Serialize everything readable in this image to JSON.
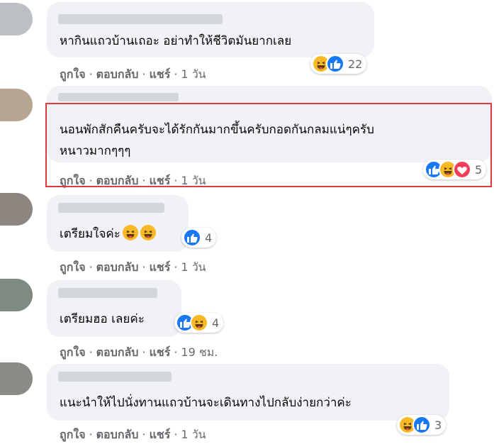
{
  "comments": [
    {
      "text": "หากินแถวบ้านเถอะ อย่าทำให้ชีวิตมันยากเลย",
      "actions": {
        "like": "ถูกใจ",
        "reply": "ตอบกลับ",
        "share": "แชร์",
        "time": "1 วัน"
      },
      "reaction_count": "22",
      "reaction_icons": [
        "haha-icon",
        "like-icon"
      ]
    },
    {
      "text_lines": [
        "นอนพักสักคืนครับจะได้รักกันมากขึ้นครับกอดกันกลมแน่ๆครับ",
        "หนาวมากๆๆๆ"
      ],
      "actions": {
        "like": "ถูกใจ",
        "reply": "ตอบกลับ",
        "share": "แชร์",
        "time": "1 วัน"
      },
      "reaction_count": "5",
      "reaction_icons": [
        "like-icon",
        "haha-icon",
        "love-icon"
      ]
    },
    {
      "text": "เตรียมใจค่ะ",
      "inline_emojis": [
        "rolling-laughing-emoji",
        "grinning-squint-emoji"
      ],
      "actions": {
        "like": "ถูกใจ",
        "reply": "ตอบกลับ",
        "share": "แชร์",
        "time": "1 วัน"
      },
      "reaction_count": "4",
      "reaction_icons": [
        "like-icon"
      ]
    },
    {
      "text": "เตรียมฮอ เลยค่ะ",
      "actions": {
        "like": "ถูกใจ",
        "reply": "ตอบกลับ",
        "share": "แชร์",
        "time": "19 ชม."
      },
      "reaction_count": "4",
      "reaction_icons": [
        "like-icon",
        "haha-icon"
      ]
    },
    {
      "text": "แนะนำให้ไปนั่งทานแถวบ้านจะเดินทางไปกลับง่ายกว่าค่ะ",
      "actions": {
        "like": "ถูกใจ",
        "reply": "ตอบกลับ",
        "share": "แชร์",
        "time": "1 วัน"
      },
      "reaction_count": "3",
      "reaction_icons": [
        "haha-icon",
        "like-icon"
      ]
    }
  ],
  "separator": "·",
  "colors": {
    "bubble": "#f0f2f5",
    "meta_text": "#65676b",
    "like_blue": "#1877f2",
    "haha_yellow": "#f7b928",
    "love_red": "#f33e58",
    "highlight_border": "#e0393e"
  }
}
